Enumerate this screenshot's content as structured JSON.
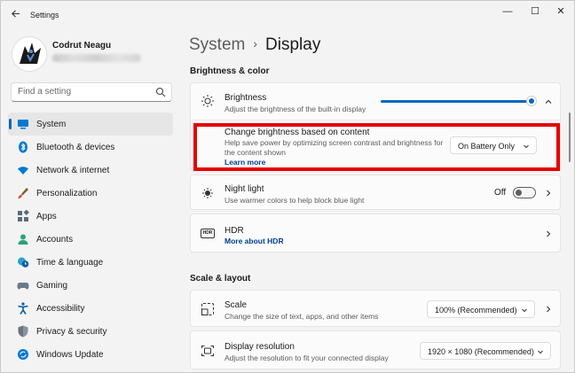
{
  "window": {
    "app_title": "Settings",
    "controls": {
      "minimize": "—",
      "maximize": "☐",
      "close": "✕"
    }
  },
  "user": {
    "name": "Codrut Neagu"
  },
  "search": {
    "placeholder": "Find a setting"
  },
  "sidebar": {
    "items": [
      {
        "label": "System",
        "icon": "monitor-icon",
        "selected": true
      },
      {
        "label": "Bluetooth & devices",
        "icon": "bluetooth-icon"
      },
      {
        "label": "Network & internet",
        "icon": "wifi-icon"
      },
      {
        "label": "Personalization",
        "icon": "brush-icon"
      },
      {
        "label": "Apps",
        "icon": "apps-icon"
      },
      {
        "label": "Accounts",
        "icon": "person-icon"
      },
      {
        "label": "Time & language",
        "icon": "clock-globe-icon"
      },
      {
        "label": "Gaming",
        "icon": "gamepad-icon"
      },
      {
        "label": "Accessibility",
        "icon": "accessibility-icon"
      },
      {
        "label": "Privacy & security",
        "icon": "shield-icon"
      },
      {
        "label": "Windows Update",
        "icon": "update-icon"
      }
    ]
  },
  "breadcrumb": {
    "parent": "System",
    "separator": "›",
    "current": "Display"
  },
  "sections": {
    "brightness_color": "Brightness & color",
    "scale_layout": "Scale & layout"
  },
  "brightness": {
    "title": "Brightness",
    "description": "Adjust the brightness of the built-in display",
    "level": 1.0
  },
  "content_brightness": {
    "title": "Change brightness based on content",
    "description_line1": "Help save power by optimizing screen contrast and brightness for",
    "description_line2": "the content shown",
    "link": "Learn more",
    "dropdown_value": "On Battery Only"
  },
  "night_light": {
    "title": "Night light",
    "description": "Use warmer colors to help block blue light",
    "state": "Off"
  },
  "hdr": {
    "title": "HDR",
    "link": "More about HDR",
    "icon_text": "HDR"
  },
  "scale": {
    "title": "Scale",
    "description": "Change the size of text, apps, and other items",
    "dropdown_value": "100% (Recommended)"
  },
  "resolution": {
    "title": "Display resolution",
    "description": "Adjust the resolution to fit your connected display",
    "dropdown_value": "1920 × 1080 (Recommended)"
  },
  "colors": {
    "accent": "#0067c0",
    "highlight": "#e60000"
  }
}
